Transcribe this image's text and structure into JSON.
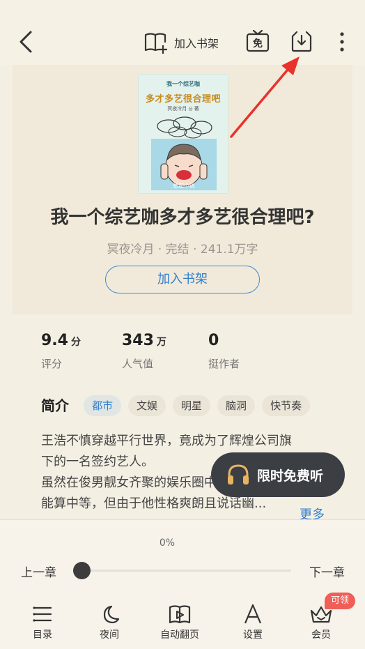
{
  "header": {
    "back_icon": "back-chevron-icon",
    "add_shelf_label": "加入书架",
    "free_icon_text": "免",
    "download_icon": "download-icon",
    "more_icon": "more-vertical-icon"
  },
  "book": {
    "cover": {
      "top_text": "我一个综艺咖",
      "title_text": "多才多艺很合理吧",
      "author_text": "冥夜冷月 ◎ 著",
      "watermark": "番茄小说"
    },
    "title": "我一个综艺咖多才多艺很合理吧?",
    "meta": "冥夜冷月 · 完结 · 241.1万字",
    "add_button": "加入书架"
  },
  "stats": [
    {
      "value": "9.4",
      "unit": "分",
      "caption": "评分"
    },
    {
      "value": "343",
      "unit": "万",
      "caption": "人气值"
    },
    {
      "value": "0",
      "unit": "",
      "caption": "挺作者"
    }
  ],
  "intro": {
    "heading": "简介",
    "tags": [
      "都市",
      "文娱",
      "明星",
      "脑洞",
      "快节奏"
    ],
    "line1": "王浩不慎穿越平行世界，竟成为了辉煌公司旗",
    "line2": "下的一名签约艺人。",
    "line3": "虽然在俊男靓女齐聚的娱乐圈中，他",
    "line4": "能算中等，但由于他性格爽朗且说话幽...",
    "more": "更多"
  },
  "listen_button": "限时免费听",
  "reader_panel": {
    "progress": "0%",
    "progress_fraction": 0,
    "prev": "上一章",
    "next": "下一章",
    "nav": [
      {
        "label": "目录",
        "icon": "list-icon"
      },
      {
        "label": "夜间",
        "icon": "moon-icon"
      },
      {
        "label": "自动翻页",
        "icon": "auto-page-icon"
      },
      {
        "label": "设置",
        "icon": "font-settings-icon"
      },
      {
        "label": "会员",
        "icon": "crown-icon"
      }
    ],
    "badge": "可领"
  },
  "colors": {
    "accent": "#2f7fd0",
    "background": "#f4efe3",
    "badge": "#ef5f57",
    "arrow": "#e8322b"
  }
}
